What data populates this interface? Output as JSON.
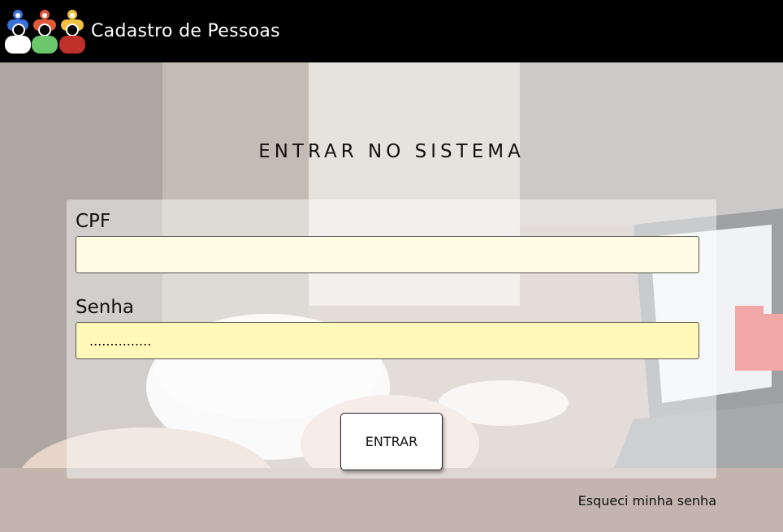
{
  "header": {
    "brand": "Cadastro de Pessoas",
    "logo_icon": "people-group-icon",
    "logo_colors": [
      "#3a6fd8",
      "#e05a3a",
      "#f0c040",
      "#ffffff",
      "#6cc66c",
      "#c0302a"
    ]
  },
  "login": {
    "title": "ENTRAR NO SISTEMA",
    "cpf_label": "CPF",
    "cpf_value": "",
    "senha_label": "Senha",
    "senha_value": "...............",
    "submit_label": "ENTRAR",
    "forgot_label": "Esqueci minha senha"
  }
}
